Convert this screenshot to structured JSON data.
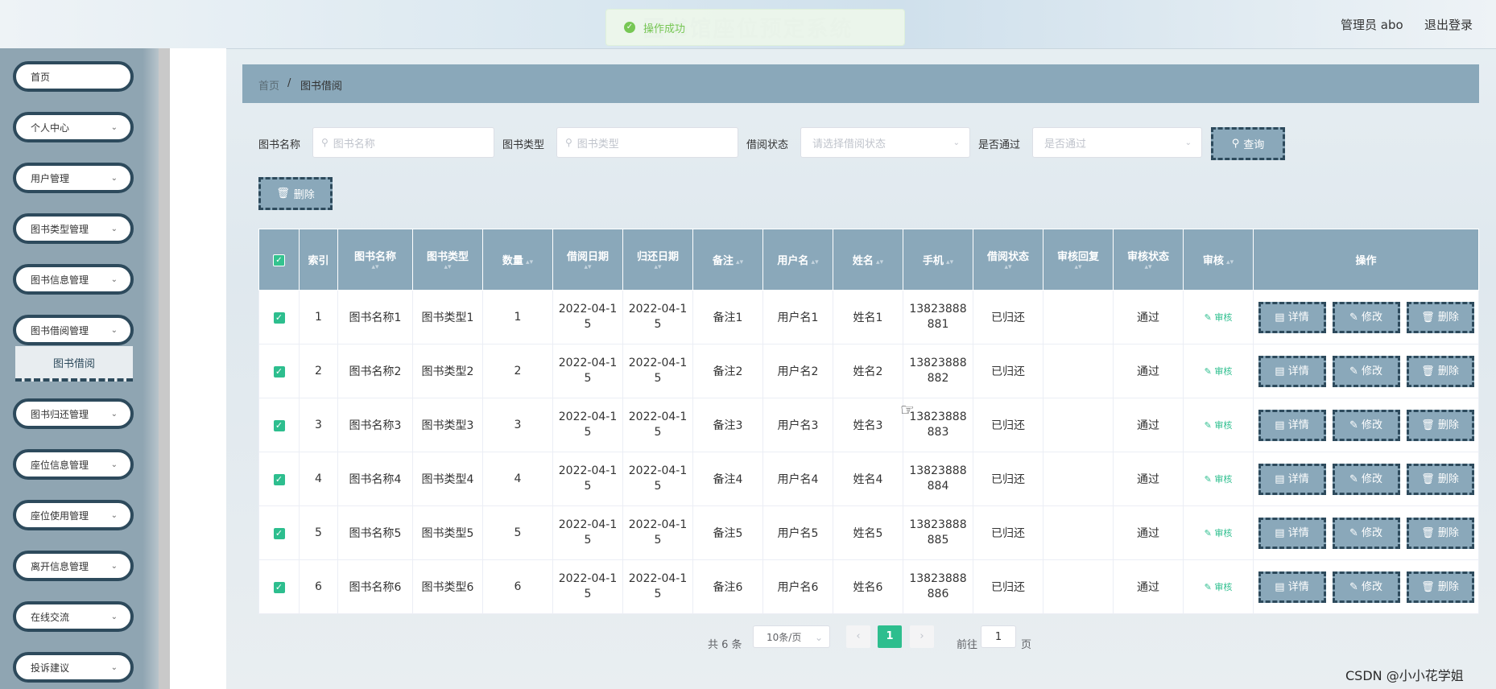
{
  "header": {
    "title": "图书馆座位预定系统",
    "toast": "操作成功",
    "admin": "管理员 abo",
    "logout": "退出登录"
  },
  "sidebar": {
    "items": [
      {
        "label": "首页",
        "chevron": false
      },
      {
        "label": "个人中心",
        "chevron": true
      },
      {
        "label": "用户管理",
        "chevron": true
      },
      {
        "label": "图书类型管理",
        "chevron": true
      },
      {
        "label": "图书信息管理",
        "chevron": true
      },
      {
        "label": "图书借阅管理",
        "chevron": true
      },
      {
        "label": "图书归还管理",
        "chevron": true
      },
      {
        "label": "座位信息管理",
        "chevron": true
      },
      {
        "label": "座位使用管理",
        "chevron": true
      },
      {
        "label": "离开信息管理",
        "chevron": true
      },
      {
        "label": "在线交流",
        "chevron": true
      },
      {
        "label": "投诉建议",
        "chevron": true
      }
    ],
    "submenu": "图书借阅"
  },
  "breadcrumb": {
    "home": "首页",
    "sep": "/",
    "current": "图书借阅"
  },
  "search": {
    "book_name_label": "图书名称",
    "book_name_placeholder": "图书名称",
    "book_type_label": "图书类型",
    "book_type_placeholder": "图书类型",
    "borrow_status_label": "借阅状态",
    "borrow_status_placeholder": "请选择借阅状态",
    "passed_label": "是否通过",
    "passed_placeholder": "是否通过",
    "query_button": "查询",
    "delete_button": "删除"
  },
  "table": {
    "headers": [
      "索引",
      "图书名称",
      "图书类型",
      "数量",
      "借阅日期",
      "归还日期",
      "备注",
      "用户名",
      "姓名",
      "手机",
      "借阅状态",
      "审核回复",
      "审核状态",
      "审核",
      "操作"
    ],
    "rows": [
      {
        "index": "1",
        "name": "图书名称1",
        "type": "图书类型1",
        "qty": "1",
        "borrow_date": "2022-04-15",
        "return_date": "2022-04-15",
        "note": "备注1",
        "username": "用户名1",
        "realname": "姓名1",
        "phone": "13823888881",
        "status": "已归还",
        "reply": "",
        "audit_status": "通过"
      },
      {
        "index": "2",
        "name": "图书名称2",
        "type": "图书类型2",
        "qty": "2",
        "borrow_date": "2022-04-15",
        "return_date": "2022-04-15",
        "note": "备注2",
        "username": "用户名2",
        "realname": "姓名2",
        "phone": "13823888882",
        "status": "已归还",
        "reply": "",
        "audit_status": "通过"
      },
      {
        "index": "3",
        "name": "图书名称3",
        "type": "图书类型3",
        "qty": "3",
        "borrow_date": "2022-04-15",
        "return_date": "2022-04-15",
        "note": "备注3",
        "username": "用户名3",
        "realname": "姓名3",
        "phone": "13823888883",
        "status": "已归还",
        "reply": "",
        "audit_status": "通过"
      },
      {
        "index": "4",
        "name": "图书名称4",
        "type": "图书类型4",
        "qty": "4",
        "borrow_date": "2022-04-15",
        "return_date": "2022-04-15",
        "note": "备注4",
        "username": "用户名4",
        "realname": "姓名4",
        "phone": "13823888884",
        "status": "已归还",
        "reply": "",
        "audit_status": "通过"
      },
      {
        "index": "5",
        "name": "图书名称5",
        "type": "图书类型5",
        "qty": "5",
        "borrow_date": "2022-04-15",
        "return_date": "2022-04-15",
        "note": "备注5",
        "username": "用户名5",
        "realname": "姓名5",
        "phone": "13823888885",
        "status": "已归还",
        "reply": "",
        "audit_status": "通过"
      },
      {
        "index": "6",
        "name": "图书名称6",
        "type": "图书类型6",
        "qty": "6",
        "borrow_date": "2022-04-15",
        "return_date": "2022-04-15",
        "note": "备注6",
        "username": "用户名6",
        "realname": "姓名6",
        "phone": "13823888886",
        "status": "已归还",
        "reply": "",
        "audit_status": "通过"
      }
    ],
    "audit_link": "审核",
    "detail_button": "详情",
    "edit_button": "修改",
    "delete_button": "删除"
  },
  "pagination": {
    "total": "共 6 条",
    "page_size": "10条/页",
    "current_page": "1",
    "goto_label": "前往",
    "goto_value": "1",
    "goto_suffix": "页"
  },
  "watermark": "CSDN @小小花学姐",
  "colors": {
    "accent": "#8aa8ba",
    "dark": "#2d4a5c",
    "green": "#2dbe8e"
  }
}
